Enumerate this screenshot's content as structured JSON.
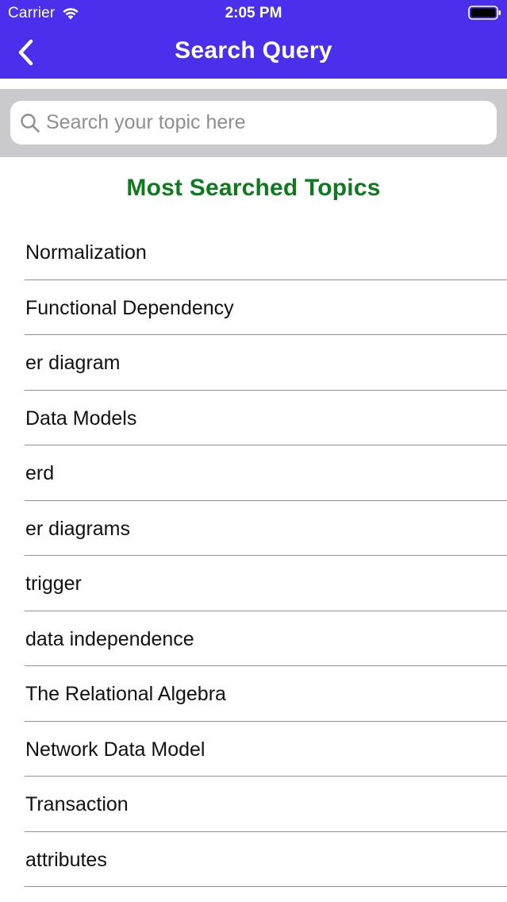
{
  "status_bar": {
    "carrier": "Carrier",
    "time": "2:05 PM"
  },
  "nav": {
    "title": "Search Query",
    "back_icon": "chevron-left-icon"
  },
  "search": {
    "placeholder": "Search your topic here",
    "value": "",
    "icon": "search-icon"
  },
  "section": {
    "title": "Most Searched Topics"
  },
  "topics": [
    {
      "label": "Normalization"
    },
    {
      "label": "Functional Dependency"
    },
    {
      "label": "er diagram"
    },
    {
      "label": "Data Models"
    },
    {
      "label": "erd"
    },
    {
      "label": "er diagrams"
    },
    {
      "label": "trigger"
    },
    {
      "label": "data independence"
    },
    {
      "label": "The Relational Algebra"
    },
    {
      "label": "Network Data Model"
    },
    {
      "label": "Transaction"
    },
    {
      "label": "attributes"
    }
  ],
  "colors": {
    "header": "#4a30ec",
    "section_title": "#0d7a1d",
    "search_area": "#c9c9ce"
  }
}
